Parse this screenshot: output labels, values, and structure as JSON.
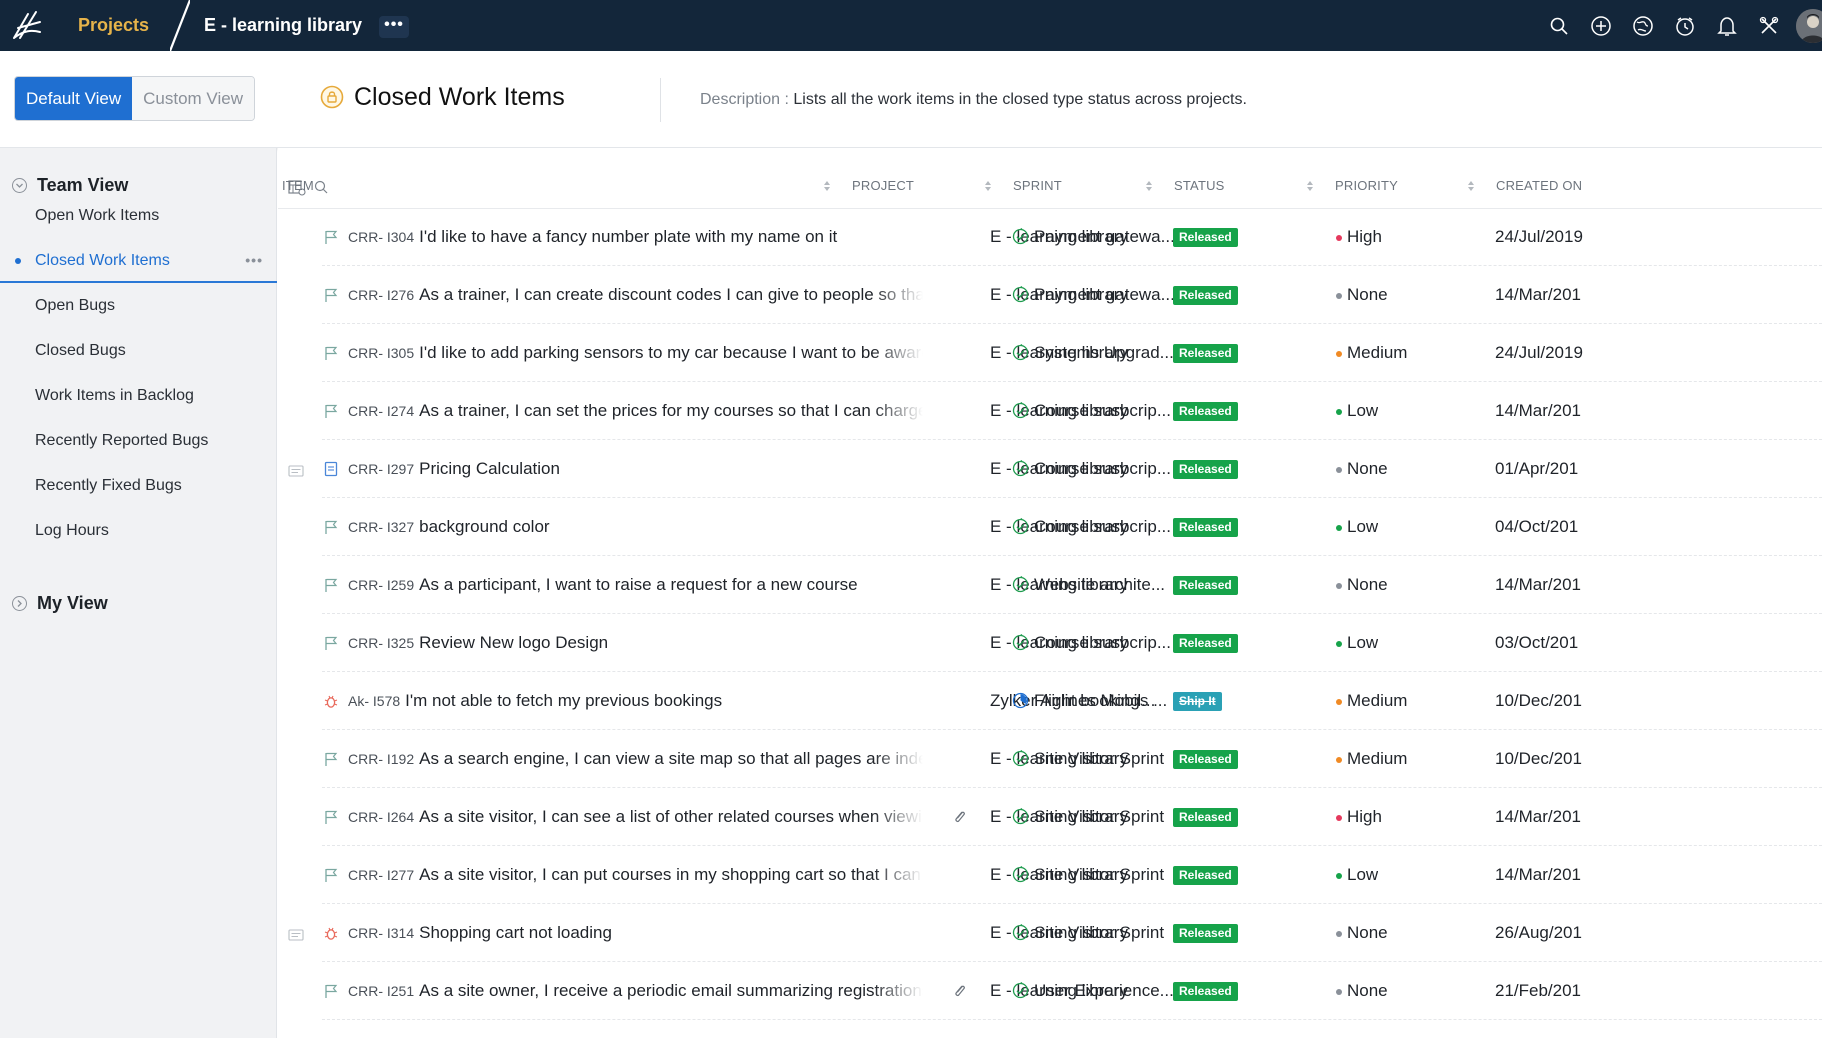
{
  "topbar": {
    "projects_label": "Projects",
    "project_name": "E - learning library",
    "more_label": "•••"
  },
  "view_toggle": {
    "default_label": "Default View",
    "custom_label": "Custom View"
  },
  "view": {
    "title": "Closed Work Items",
    "description_label": "Description :",
    "description": "Lists all the work items in the closed type status across projects."
  },
  "sidebar": {
    "team_view": "Team View",
    "my_view": "My View",
    "items": [
      {
        "label": "Open Work Items",
        "active": false
      },
      {
        "label": "Closed Work Items",
        "active": true
      },
      {
        "label": "Open Bugs",
        "active": false
      },
      {
        "label": "Closed Bugs",
        "active": false
      },
      {
        "label": "Work Items in Backlog",
        "active": false
      },
      {
        "label": "Recently Reported Bugs",
        "active": false
      },
      {
        "label": "Recently Fixed Bugs",
        "active": false
      },
      {
        "label": "Log Hours",
        "active": false
      }
    ],
    "more_label": "•••"
  },
  "table": {
    "columns": {
      "item": "ITEM",
      "project": "PROJECT",
      "sprint": "SPRINT",
      "status": "STATUS",
      "priority": "PRIORITY",
      "created_on": "CREATED ON"
    },
    "rows": [
      {
        "id": "CRR- I304",
        "title": "I'd like to have a fancy number plate with my name on it",
        "type": "story",
        "project": "E - learning library",
        "sprint": "Payment gatewa...",
        "sprint_icon": "completed",
        "status": "Released",
        "priority": "High",
        "created": "24/Jul/2019"
      },
      {
        "id": "CRR- I276",
        "title": "As a trainer, I can create discount codes I can give to people so that I can cu",
        "type": "story",
        "project": "E - learning library",
        "sprint": "Payment gatewa...",
        "sprint_icon": "completed",
        "status": "Released",
        "priority": "None",
        "created": "14/Mar/201"
      },
      {
        "id": "CRR- I305",
        "title": "I'd like to add parking sensors to my car because I want to be aware of my s",
        "type": "story",
        "project": "E - learning library",
        "sprint": "Systems Upgrad...",
        "sprint_icon": "completed",
        "status": "Released",
        "priority": "Medium",
        "created": "24/Jul/2019"
      },
      {
        "id": "CRR- I274",
        "title": "As a trainer, I can set the prices for my courses so that I can charge accordi",
        "type": "story",
        "project": "E - learning library",
        "sprint": "Course susbcrip...",
        "sprint_icon": "completed",
        "status": "Released",
        "priority": "Low",
        "created": "14/Mar/201"
      },
      {
        "id": "CRR- I297",
        "title": "Pricing Calculation",
        "type": "task",
        "project": "E - learning library",
        "sprint": "Course susbcrip...",
        "sprint_icon": "completed",
        "status": "Released",
        "priority": "None",
        "created": "01/Apr/201"
      },
      {
        "id": "CRR- I327",
        "title": "background color",
        "type": "story",
        "project": "E - learning library",
        "sprint": "Course susbcrip...",
        "sprint_icon": "completed",
        "status": "Released",
        "priority": "Low",
        "created": "04/Oct/201"
      },
      {
        "id": "CRR- I259",
        "title": "As a participant, I want to raise a request for a new course",
        "type": "story",
        "project": "E - learning library",
        "sprint": "Website archite...",
        "sprint_icon": "completed",
        "status": "Released",
        "priority": "None",
        "created": "14/Mar/201"
      },
      {
        "id": "CRR- I325",
        "title": "Review New logo Design",
        "type": "story",
        "project": "E - learning library",
        "sprint": "Course susbcrip...",
        "sprint_icon": "completed",
        "status": "Released",
        "priority": "Low",
        "created": "03/Oct/201"
      },
      {
        "id": "Ak- I578",
        "title": "I'm not able to fetch my previous bookings",
        "type": "bug",
        "project": "Zylker Airlines Mobil...",
        "sprint": "Flight bookings ...",
        "sprint_icon": "active",
        "status": "Ship It",
        "priority": "Medium",
        "created": "10/Dec/201"
      },
      {
        "id": "CRR- I192",
        "title": "As a search engine, I can view a site map so that all pages are indexed.",
        "type": "story",
        "project": "E - learning library",
        "sprint": "Site Visitor Sprint",
        "sprint_icon": "completed",
        "status": "Released",
        "priority": "Medium",
        "created": "10/Dec/201"
      },
      {
        "id": "CRR- I264",
        "title": "As a site visitor, I can see a list of other related courses when viewing",
        "type": "story",
        "project": "E - learning library",
        "sprint": "Site Visitor Sprint",
        "sprint_icon": "completed",
        "status": "Released",
        "priority": "High",
        "created": "14/Mar/201"
      },
      {
        "id": "CRR- I277",
        "title": "As a site visitor, I can put courses in my shopping cart so that I can purchas",
        "type": "story",
        "project": "E - learning library",
        "sprint": "Site Visitor Sprint",
        "sprint_icon": "completed",
        "status": "Released",
        "priority": "Low",
        "created": "14/Mar/201"
      },
      {
        "id": "CRR- I314",
        "title": "Shopping cart not loading",
        "type": "bug",
        "project": "E - learning library",
        "sprint": "Site Visitor Sprint",
        "sprint_icon": "completed",
        "status": "Released",
        "priority": "None",
        "created": "26/Aug/201"
      },
      {
        "id": "CRR- I251",
        "title": "As a site owner, I receive a periodic email summarizing registrations f",
        "type": "story",
        "project": "E - learning library",
        "sprint": "User Experience...",
        "sprint_icon": "completed",
        "status": "Released",
        "priority": "None",
        "created": "21/Feb/201"
      }
    ]
  },
  "colors": {
    "topbar": "#13263a",
    "accent": "#1f6fd1",
    "released": "#16a34a",
    "ship_it": "#2aa1b5",
    "priority_high": "#e5395d",
    "priority_medium": "#f08a24",
    "priority_low": "#16a34a",
    "priority_none": "#8a9099"
  }
}
